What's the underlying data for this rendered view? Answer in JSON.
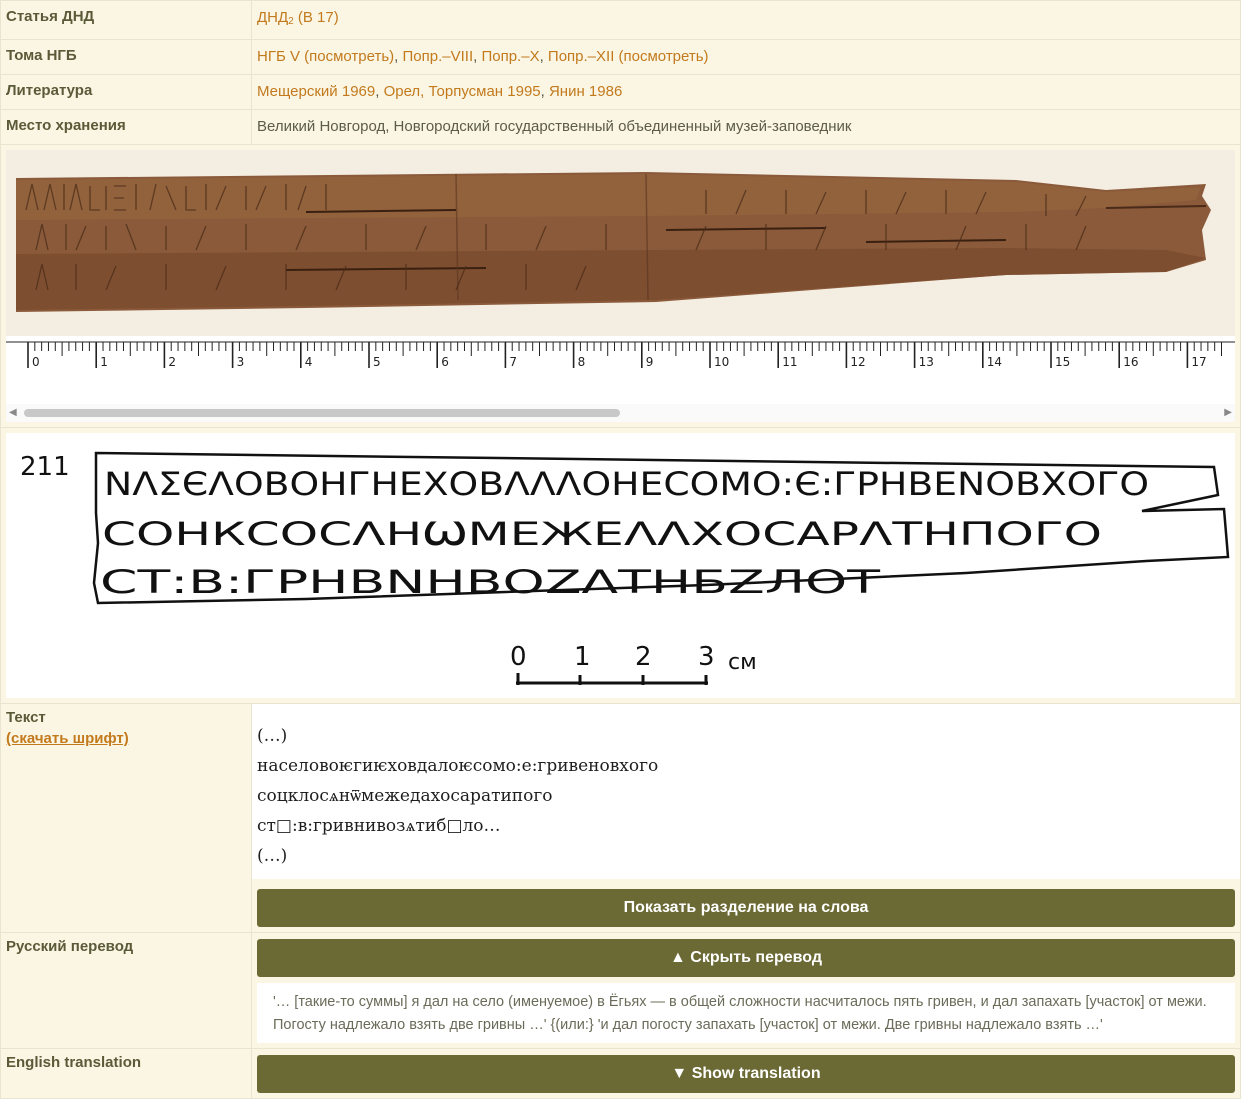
{
  "rows": {
    "statya": {
      "label": "Статья ДНД",
      "value": "ДНД",
      "value_sub": "2",
      "value_rest": " (B 17)"
    },
    "toma": {
      "label": "Тома НГБ",
      "parts": [
        "НГБ V (посмотреть)",
        ", ",
        "Попр.–VIII",
        ", ",
        "Попр.–X",
        ", ",
        "Попр.–XII (посмотреть)"
      ]
    },
    "lit": {
      "label": "Литература",
      "parts": [
        "Мещерский 1969",
        ", ",
        "Орел, Торпусман 1995",
        ", ",
        "Янин 1986"
      ]
    },
    "mesto": {
      "label": "Место хранения",
      "value": "Великий Новгород, Новгородский государственный объединенный музей-заповедник"
    }
  },
  "ruler": {
    "labels": [
      "0",
      "1",
      "2",
      "3",
      "4",
      "5",
      "6",
      "7",
      "8",
      "9",
      "10",
      "11",
      "12",
      "13",
      "14",
      "15",
      "16",
      "17"
    ]
  },
  "drawing": {
    "number": "211",
    "line1": "NΛΣЄΛОВОНГНЕХОВΛΛΛОНЕСОМО:Є:ГРНВЕNОВХОГО",
    "line2": "СОНКСОСΛНѠМЕЖЕΛΛХОСАРΛТНПОГО",
    "line3": "СТ:В:ГРНВNНВОZΛТНБZЛОТ",
    "scale_labels": [
      "0",
      "1",
      "2",
      "3",
      "см"
    ]
  },
  "text_section": {
    "label": "Текст",
    "font_link": "(скачать шрифт)",
    "lines": [
      "(…)",
      "населовоѥгиѥховдалоѥсомо:е:гривеновхого",
      "соцклосѧнѿмежедахосаратипого",
      "ст□:в:гривнивозѧтиб□ло…",
      "(…)"
    ],
    "button": "Показать разделение на слова"
  },
  "russian": {
    "label": "Русский перевод",
    "button": "▲ Скрыть перевод",
    "text": "'… [такие-то суммы] я дал на село (именуемое) в Ёгьях — в общей сложности насчиталось пять гривен, и дал запахать [участок] от межи. Погосту надлежало взять две гривны …' {(или:} 'и дал погосту запахать [участок] от межи. Две гривны надлежало взять …'"
  },
  "english": {
    "label": "English translation",
    "button": "▼ Show translation"
  }
}
